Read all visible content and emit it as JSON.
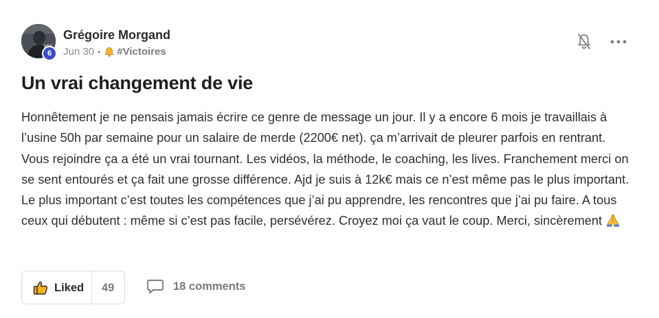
{
  "post": {
    "author": {
      "name": "Grégoire Morgand",
      "level": "6"
    },
    "date": "Jun 30",
    "separator": "•",
    "category": "#Victoires",
    "category_icon": "bell-emoji-icon",
    "title": "Un vrai changement de vie",
    "body": "Honnêtement je ne pensais jamais écrire ce genre de message un jour. Il y a encore 6 mois je travaillais à l’usine 50h par semaine pour un salaire de merde (2200€ net). ça m’arrivait de pleurer parfois en rentrant. Vous rejoindre ça a été un vrai tournant. Les vidéos, la méthode, le coaching, les lives. Franchement merci on se sent entourés et ça fait une grosse différence. Ajd je suis à 12k€ mais ce n’est même pas le plus important. Le plus important c’est toutes les compétences que j’ai pu apprendre, les rencontres que j’ai pu faire. A tous ceux qui débutent : même si c’est pas facile, persévérez. Croyez moi ça vaut le coup. Merci, sincèrement",
    "body_end_icon": "folded-hands-emoji-icon"
  },
  "actions": {
    "like_label": "Liked",
    "like_count": "49",
    "comments_label": "18 comments",
    "notify_icon": "bell-off-icon",
    "more_icon": "more-horizontal-icon"
  },
  "colors": {
    "badge": "#3b4fc4",
    "like_thumb": "#f5b027",
    "text": "#2f2f2f",
    "muted": "#8a8a8a"
  }
}
